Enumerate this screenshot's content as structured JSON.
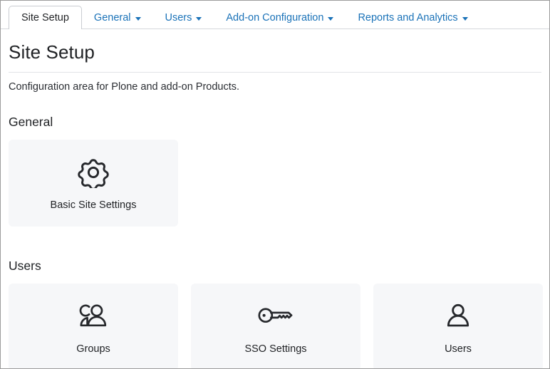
{
  "tabs": [
    {
      "label": "Site Setup",
      "active": true,
      "has_caret": false,
      "name": "tab-site-setup"
    },
    {
      "label": "General",
      "active": false,
      "has_caret": true,
      "name": "tab-general"
    },
    {
      "label": "Users",
      "active": false,
      "has_caret": true,
      "name": "tab-users"
    },
    {
      "label": "Add-on Configuration",
      "active": false,
      "has_caret": true,
      "name": "tab-addon-configuration"
    },
    {
      "label": "Reports and Analytics",
      "active": false,
      "has_caret": true,
      "name": "tab-reports-and-analytics"
    }
  ],
  "page": {
    "title": "Site Setup",
    "description": "Configuration area for Plone and add-on Products."
  },
  "sections": [
    {
      "heading": "General",
      "cards": [
        {
          "label": "Basic Site Settings",
          "icon": "gear-icon",
          "name": "card-basic-site-settings"
        }
      ]
    },
    {
      "heading": "Users",
      "cards": [
        {
          "label": "Groups",
          "icon": "users-group-icon",
          "name": "card-groups"
        },
        {
          "label": "SSO Settings",
          "icon": "key-icon",
          "name": "card-sso-settings"
        },
        {
          "label": "Users",
          "icon": "user-icon",
          "name": "card-users"
        }
      ]
    }
  ],
  "colors": {
    "link": "#1a72b8",
    "text": "#1f2124",
    "card_bg": "#f6f7f9",
    "border": "#d5d8dc",
    "frame": "#9c9c9c"
  }
}
